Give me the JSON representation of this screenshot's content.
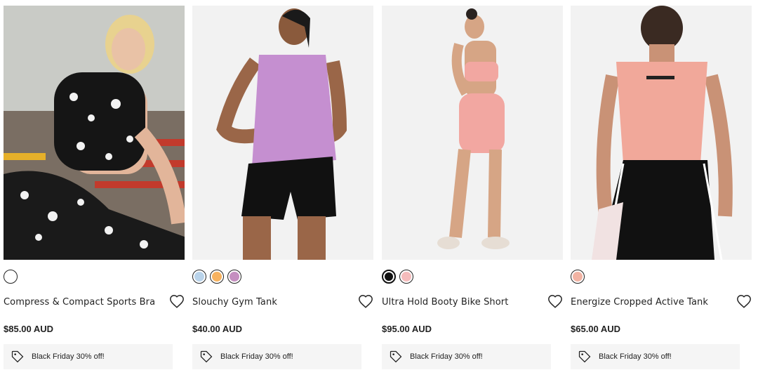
{
  "products": [
    {
      "name": "Compress & Compact Sports Bra",
      "price": "$85.00 AUD",
      "promo": "Black Friday 30% off!",
      "image": "woman-in-leopard-print-sports-bra-and-leggings",
      "swatches": [
        "#ffffff"
      ]
    },
    {
      "name": "Slouchy Gym Tank",
      "price": "$40.00 AUD",
      "promo": "Black Friday 30% off!",
      "image": "woman-in-lilac-tank-and-black-shorts",
      "swatches": [
        "#b9d3ea",
        "#f7b25f",
        "#c58fc0"
      ]
    },
    {
      "name": "Ultra Hold Booty Bike Short",
      "price": "$95.00 AUD",
      "promo": "Black Friday 30% off!",
      "image": "woman-in-peach-bike-shorts-back-view",
      "swatches": [
        "#111111",
        "#f5bcbc"
      ]
    },
    {
      "name": "Energize Cropped Active Tank",
      "price": "$65.00 AUD",
      "promo": "Black Friday 30% off!",
      "image": "woman-in-pink-cropped-tank-back-view",
      "swatches": [
        "#f1b3a3"
      ]
    }
  ],
  "icons": {
    "wishlist": "heart-icon",
    "promo": "tag-icon"
  }
}
